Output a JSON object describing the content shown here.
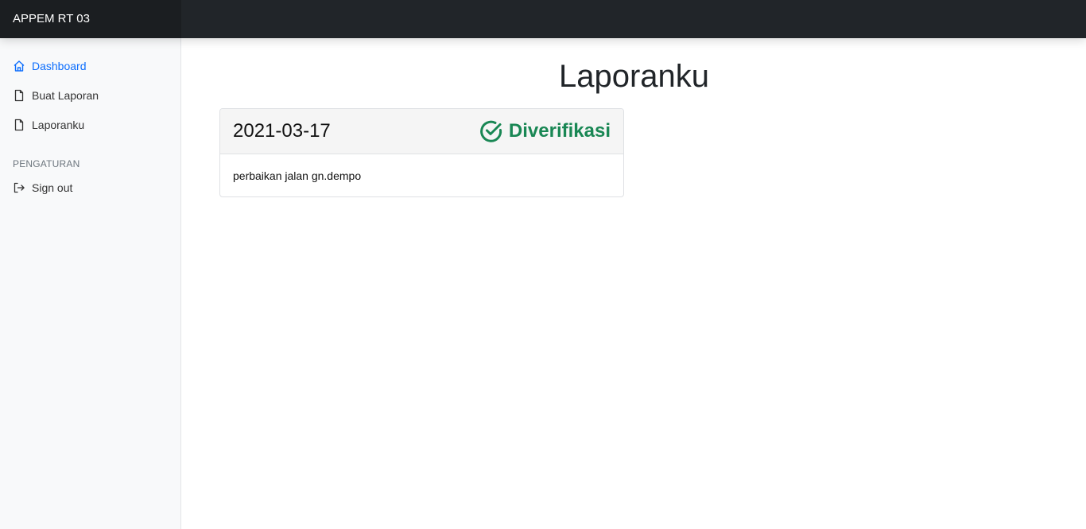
{
  "header": {
    "brand": "APPEM RT 03"
  },
  "sidebar": {
    "items": [
      {
        "label": "Dashboard",
        "icon": "home-icon"
      },
      {
        "label": "Buat Laporan",
        "icon": "file-icon"
      },
      {
        "label": "Laporanku",
        "icon": "file-icon"
      }
    ],
    "section_title": "PENGATURAN",
    "signout": {
      "label": "Sign out",
      "icon": "sign-out-icon"
    }
  },
  "main": {
    "title": "Laporanku",
    "reports": [
      {
        "date": "2021-03-17",
        "status": "Diverifikasi",
        "description": "perbaikan jalan gn.dempo"
      }
    ]
  },
  "colors": {
    "active": "#0d6efd",
    "status_verified": "#198754",
    "topbar": "#212529"
  }
}
